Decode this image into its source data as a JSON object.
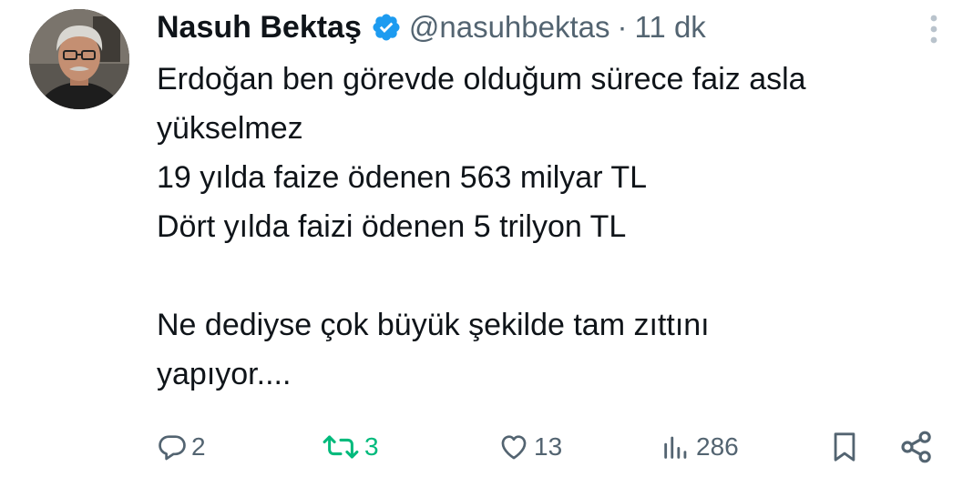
{
  "author": {
    "name": "Nasuh Bektaş",
    "handle": "@nasuhbektas",
    "separator": "·",
    "time": "11 dk",
    "verified": true
  },
  "tweet": {
    "lines": [
      "Erdoğan ben görevde olduğum sürece faiz asla",
      "yükselmez",
      "19 yılda faize ödenen 563 milyar TL",
      "Dört yılda faizi ödenen 5 trilyon TL",
      "",
      "Ne dediyse çok büyük şekilde tam zıttını",
      "yapıyor...."
    ]
  },
  "actions": {
    "replies": "2",
    "retweets": "3",
    "likes": "13",
    "views": "286"
  },
  "colors": {
    "text": "#0f1419",
    "muted": "#536471",
    "verified_badge": "#1d9bf0",
    "retweet_green": "#00ba7c",
    "more_dots": "#b9c3cc"
  },
  "icons": {
    "verified": "verified-badge-icon",
    "more": "more-dots-icon",
    "reply": "reply-icon",
    "retweet": "retweet-icon",
    "like": "heart-icon",
    "views": "views-bars-icon",
    "bookmark": "bookmark-icon",
    "share": "share-icon"
  }
}
